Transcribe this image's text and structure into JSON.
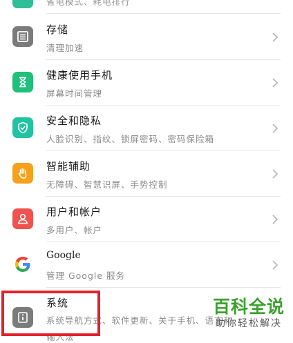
{
  "partial_item": {
    "subtitle": "省电模式、耗电排行"
  },
  "items": [
    {
      "id": "storage",
      "title": "存储",
      "subtitle": "清理加速",
      "icon": "storage-icon",
      "color": "#7b7b7b"
    },
    {
      "id": "digital-balance",
      "title": "健康使用手机",
      "subtitle": "屏幕时间管理",
      "icon": "hourglass-icon",
      "color": "#1fc07a"
    },
    {
      "id": "security",
      "title": "安全和隐私",
      "subtitle": "人脸识别、指纹、锁屏密码、密码保险箱",
      "icon": "shield-check-icon",
      "color": "#20c4a3"
    },
    {
      "id": "accessibility",
      "title": "智能辅助",
      "subtitle": "无障碍、智慧识屏、手势控制",
      "icon": "hand-icon",
      "color": "#f5a11c"
    },
    {
      "id": "accounts",
      "title": "用户和帐户",
      "subtitle": "多用户、帐户",
      "icon": "user-icon",
      "color": "#f0524f"
    },
    {
      "id": "google",
      "title": "Google",
      "subtitle": "管理 Google 服务",
      "icon": "google-icon",
      "color": "#4285f4"
    },
    {
      "id": "system",
      "title": "系统",
      "subtitle": "系统导航方式、软件更新、关于手机、语言和",
      "subtitle2": "输入法",
      "icon": "info-icon",
      "color": "#7b7b7b"
    }
  ],
  "watermark": {
    "main": "百科全说",
    "sub": "助你轻松解决"
  }
}
